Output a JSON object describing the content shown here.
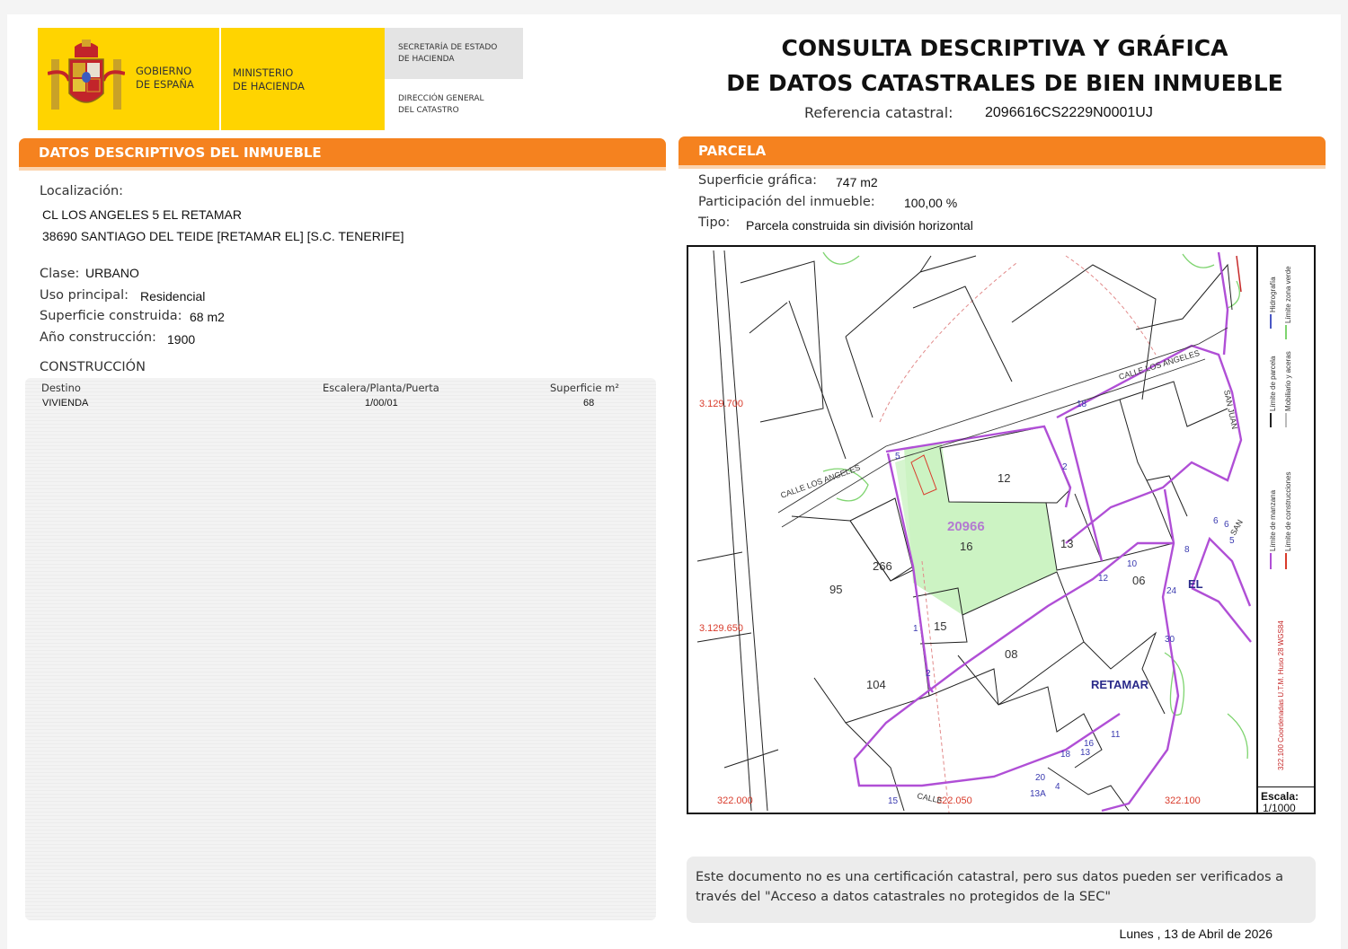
{
  "header": {
    "gobierno": [
      "GOBIERNO",
      "DE ESPAÑA"
    ],
    "ministerio": [
      "MINISTERIO",
      "DE HACIENDA"
    ],
    "secretaria": [
      "SECRETARÍA DE ESTADO",
      "DE HACIENDA"
    ],
    "direccion": [
      "DIRECCIÓN GENERAL",
      "DEL CATASTRO"
    ],
    "title_line1": "CONSULTA DESCRIPTIVA Y GRÁFICA",
    "title_line2": "DE DATOS CATASTRALES DE BIEN INMUEBLE",
    "ref_label": "Referencia catastral:",
    "ref_value": "2096616CS2229N0001UJ"
  },
  "descriptivos": {
    "section_title": "DATOS DESCRIPTIVOS DEL INMUEBLE",
    "localizacion_label": "Localización:",
    "address_line1": "CL LOS ANGELES 5 EL RETAMAR",
    "address_line2": "38690 SANTIAGO DEL TEIDE [RETAMAR EL] [S.C. TENERIFE]",
    "clase_label": "Clase:",
    "clase_value": "URBANO",
    "uso_label": "Uso principal:",
    "uso_value": "Residencial",
    "superficie_label": "Superficie construida:",
    "superficie_value": "68 m2",
    "anio_label": "Año construcción:",
    "anio_value": "1900"
  },
  "construccion": {
    "title": "CONSTRUCCIÓN",
    "columns": [
      "Destino",
      "Escalera/Planta/Puerta",
      "Superficie m²"
    ],
    "rows": [
      [
        "VIVIENDA",
        "1/00/01",
        "68"
      ]
    ]
  },
  "parcela": {
    "section_title": "PARCELA",
    "superficie_label": "Superficie gráfica:",
    "superficie_value": "747 m2",
    "participacion_label": "Participación del inmueble:",
    "participacion_value": "100,00 %",
    "tipo_label": "Tipo:",
    "tipo_value": "Parcela construida sin división horizontal"
  },
  "map": {
    "coord_y_top": "3.129.700",
    "coord_y_mid": "3.129.650",
    "coord_x_left": "322.000",
    "coord_x_mid": "322.050",
    "coord_x_right": "322.100",
    "block_id": "20966",
    "parcel_labels": [
      "12",
      "16",
      "13",
      "266",
      "95",
      "15",
      "08",
      "104",
      "06"
    ],
    "street_numbers": [
      "5",
      "18",
      "2",
      "1",
      "8",
      "10",
      "12",
      "6",
      "5",
      "24",
      "30",
      "15",
      "20",
      "18",
      "16",
      "13",
      "11",
      "13A",
      "4",
      "2",
      "6"
    ],
    "street_calle_los_angeles_1": "CALLE LOS ANGELES",
    "street_calle_los_angeles_2": "CALLE LOS ANGELES",
    "street_calle_bottom": "CALLE",
    "street_san_juan": "SAN JUAN",
    "street_san": "SAN",
    "label_el": "EL",
    "label_retamar": "RETAMAR",
    "legend": {
      "limite_manzana": "Límite de manzana",
      "limite_parcela": "Límite de parcela",
      "hidrografia": "Hidrografía",
      "limite_construcciones": "Límite de construcciones",
      "mobiliario": "Mobiliario y aceras",
      "limite_zona_verde": "Límite zona verde",
      "coordinates": "322.100 Coordenadas U.T.M. Huso 28 WGS84"
    },
    "escala_label": "Escala:",
    "escala_value": "1/1000",
    "colors": {
      "manzana": "#b04fd6",
      "parcela": "#222222",
      "hidro": "#4a57c4",
      "construcciones": "#d93b2b",
      "verde": "#7ed46f",
      "selected": "#ccf3c3"
    }
  },
  "note": "Este documento no es una certificación catastral, pero sus datos pueden ser verificados a través del \"Acceso a datos catastrales no protegidos de la SEC\"",
  "date": "Lunes , 13 de Abril de 2026"
}
